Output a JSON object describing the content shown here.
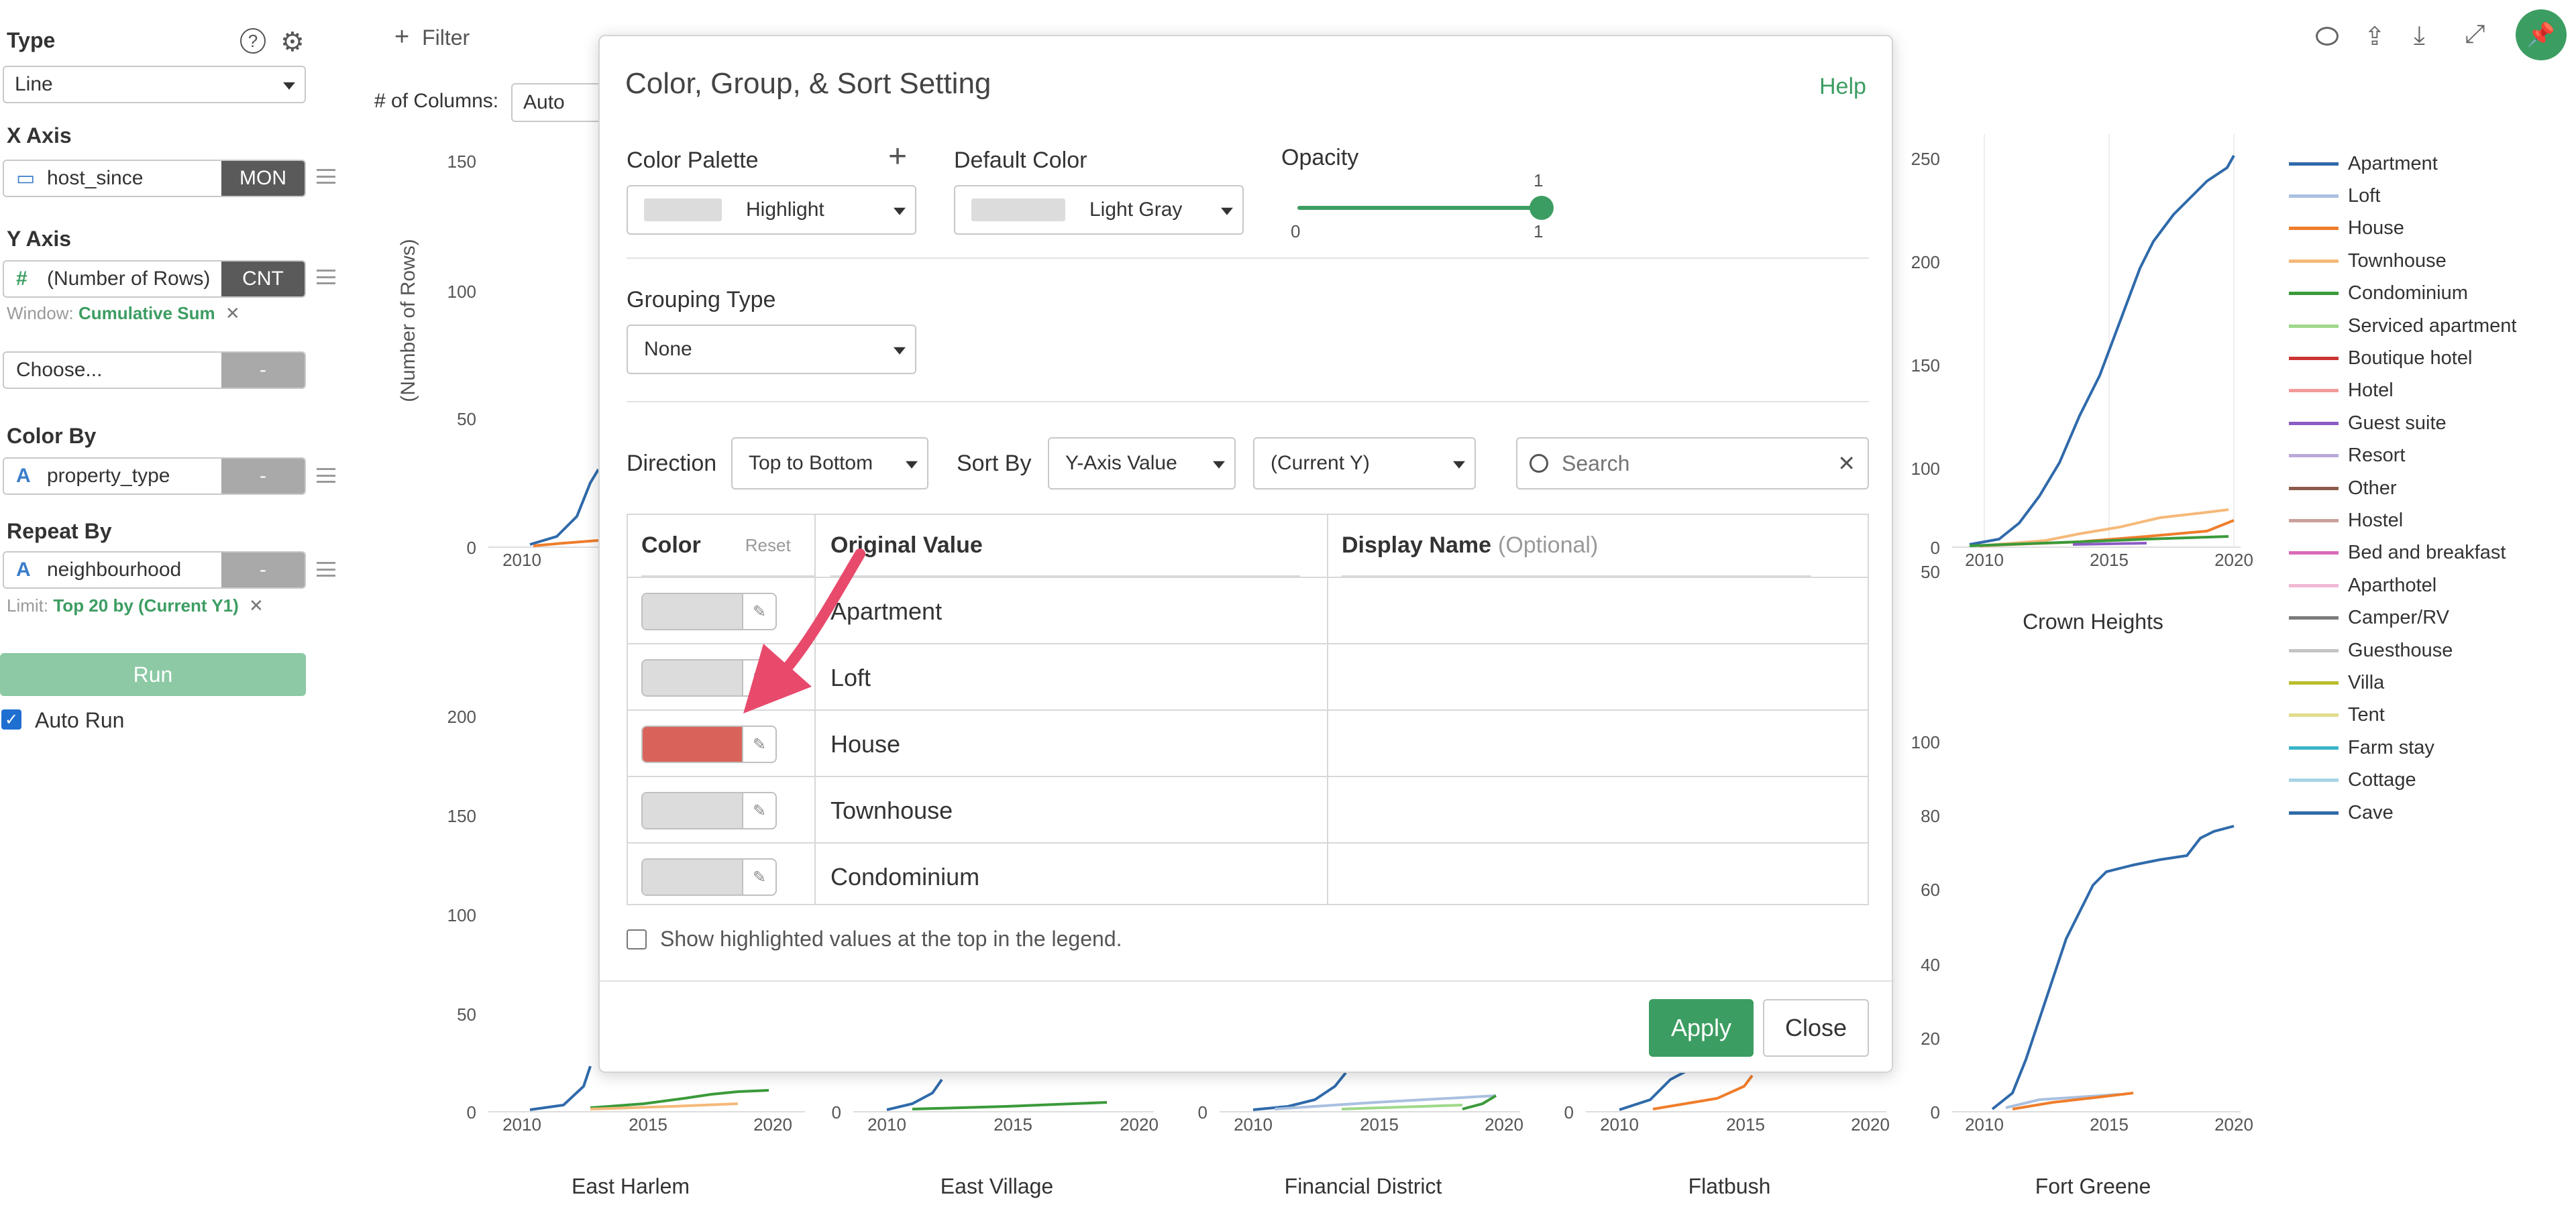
{
  "sidebar": {
    "type_title": "Type",
    "type_value": "Line",
    "xaxis_title": "X Axis",
    "xaxis_field": "host_since",
    "xaxis_tag": "MON",
    "yaxis_title": "Y Axis",
    "yaxis_field": "(Number of Rows)",
    "yaxis_tag": "CNT",
    "window_label": "Window:",
    "window_value": "Cumulative Sum",
    "choose_placeholder": "Choose...",
    "choose_tag": "-",
    "colorby_title": "Color By",
    "colorby_field": "property_type",
    "colorby_tag": "-",
    "repeatby_title": "Repeat By",
    "repeatby_field": "neighbourhood",
    "repeatby_tag": "-",
    "limit_label": "Limit:",
    "limit_value": "Top 20 by (Current Y1)",
    "run_label": "Run",
    "autorun_label": "Auto Run",
    "remove_glyph": "✕",
    "hash_glyph": "#",
    "type_a_glyph": "A"
  },
  "topbar": {
    "filter_label": "Filter",
    "plus_glyph": "+",
    "columns_label": "# of Columns:",
    "columns_value": "Auto"
  },
  "charts": {
    "ylabel": "(Number of Rows)",
    "top_row": {
      "ticks_left": [
        "150",
        "100",
        "50",
        "0"
      ],
      "xtick_left": "2010",
      "ticks_right": [
        "250",
        "200",
        "150",
        "100",
        "50",
        "0"
      ],
      "xticks_right": [
        "2010",
        "2015",
        "2020"
      ],
      "title_right": "Crown Heights"
    },
    "bottom_row": {
      "ticks_c1": [
        "200",
        "150",
        "100",
        "50",
        "0"
      ],
      "ticks_c5": [
        "100",
        "80",
        "60",
        "40",
        "20",
        "0"
      ],
      "xticks_a": [
        "2010",
        "2015",
        "2020"
      ],
      "xticks_b": [
        "2010",
        "2015",
        "2020"
      ],
      "xticks_c": [
        "2010",
        "2015",
        "2020"
      ],
      "xticks_d": [
        "2010",
        "2015",
        "2020"
      ],
      "xticks_e": [
        "2010",
        "2015",
        "2020"
      ],
      "zero": "0",
      "titles": [
        "East Harlem",
        "East Village",
        "Financial District",
        "Flatbush",
        "Fort Greene"
      ]
    }
  },
  "legend": [
    {
      "name": "Apartment",
      "color": "#2f6aaa"
    },
    {
      "name": "Loft",
      "color": "#a9c0e0"
    },
    {
      "name": "House",
      "color": "#ef7d2b"
    },
    {
      "name": "Townhouse",
      "color": "#f5b97a"
    },
    {
      "name": "Condominium",
      "color": "#3a9a3a"
    },
    {
      "name": "Serviced apartment",
      "color": "#9fd88a"
    },
    {
      "name": "Boutique hotel",
      "color": "#cc3333"
    },
    {
      "name": "Hotel",
      "color": "#f29a9a"
    },
    {
      "name": "Guest suite",
      "color": "#8a5cc4"
    },
    {
      "name": "Resort",
      "color": "#b9a9d8"
    },
    {
      "name": "Other",
      "color": "#8c5a4a"
    },
    {
      "name": "Hostel",
      "color": "#c9a09a"
    },
    {
      "name": "Bed and breakfast",
      "color": "#d96ab8"
    },
    {
      "name": "Aparthotel",
      "color": "#f2b8d4"
    },
    {
      "name": "Camper/RV",
      "color": "#7a7a7a"
    },
    {
      "name": "Guesthouse",
      "color": "#c4c4c4"
    },
    {
      "name": "Villa",
      "color": "#b8bd2a"
    },
    {
      "name": "Tent",
      "color": "#e0dc8c"
    },
    {
      "name": "Farm stay",
      "color": "#3ab5cc"
    },
    {
      "name": "Cottage",
      "color": "#a6d4e6"
    },
    {
      "name": "Cave",
      "color": "#2f6aaa"
    }
  ],
  "modal": {
    "title": "Color, Group, & Sort Setting",
    "help": "Help",
    "palette_label": "Color Palette",
    "palette_value": "Highlight",
    "palette_add": "+",
    "default_color_label": "Default Color",
    "default_color_value": "Light Gray",
    "opacity_label": "Opacity",
    "opacity_value": 1,
    "opacity_value_label": "1",
    "opacity_min": "0",
    "opacity_max": "1",
    "grouping_label": "Grouping Type",
    "grouping_value": "None",
    "direction_label": "Direction",
    "direction_value": "Top to Bottom",
    "sortby_label": "Sort By",
    "sortby_value": "Y-Axis Value",
    "sortby_sub": "(Current Y)",
    "search_placeholder": "Search",
    "col_color": "Color",
    "col_reset": "Reset",
    "col_original": "Original Value",
    "col_display": "Display Name",
    "col_display_optional": "(Optional)",
    "rows": [
      {
        "value": "Apartment",
        "color": "#dcdcdc"
      },
      {
        "value": "Loft",
        "color": "#dcdcdc"
      },
      {
        "value": "House",
        "color": "#d9635a"
      },
      {
        "value": "Townhouse",
        "color": "#dcdcdc"
      },
      {
        "value": "Condominium",
        "color": "#dcdcdc"
      }
    ],
    "show_top_label": "Show highlighted values at the top in the legend.",
    "apply_label": "Apply",
    "close_label": "Close"
  },
  "colors": {
    "accent_green": "#3c9d62",
    "run_button": "#8cc9a4",
    "arrow": "#e84a6c"
  }
}
